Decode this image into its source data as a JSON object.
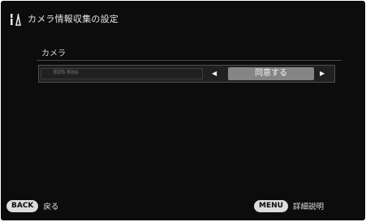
{
  "header": {
    "icon": "tools-icon",
    "title": "カメラ情報収集の設定"
  },
  "section": {
    "label": "カメラ"
  },
  "setting": {
    "camera_name": "EOS Kiss (blurred)",
    "value": "同意する",
    "prev_icon": "left-arrow-icon",
    "next_icon": "right-arrow-icon",
    "prev_glyph": "◀",
    "next_glyph": "▶"
  },
  "footer": {
    "back_button": "BACK",
    "back_text": "戻る",
    "menu_button": "MENU",
    "menu_text": "詳細説明"
  },
  "colors": {
    "background": "#0c0c0c",
    "text": "#e6e6e6",
    "value_highlight": "#858585",
    "button_pill": "#dcdcdc"
  }
}
